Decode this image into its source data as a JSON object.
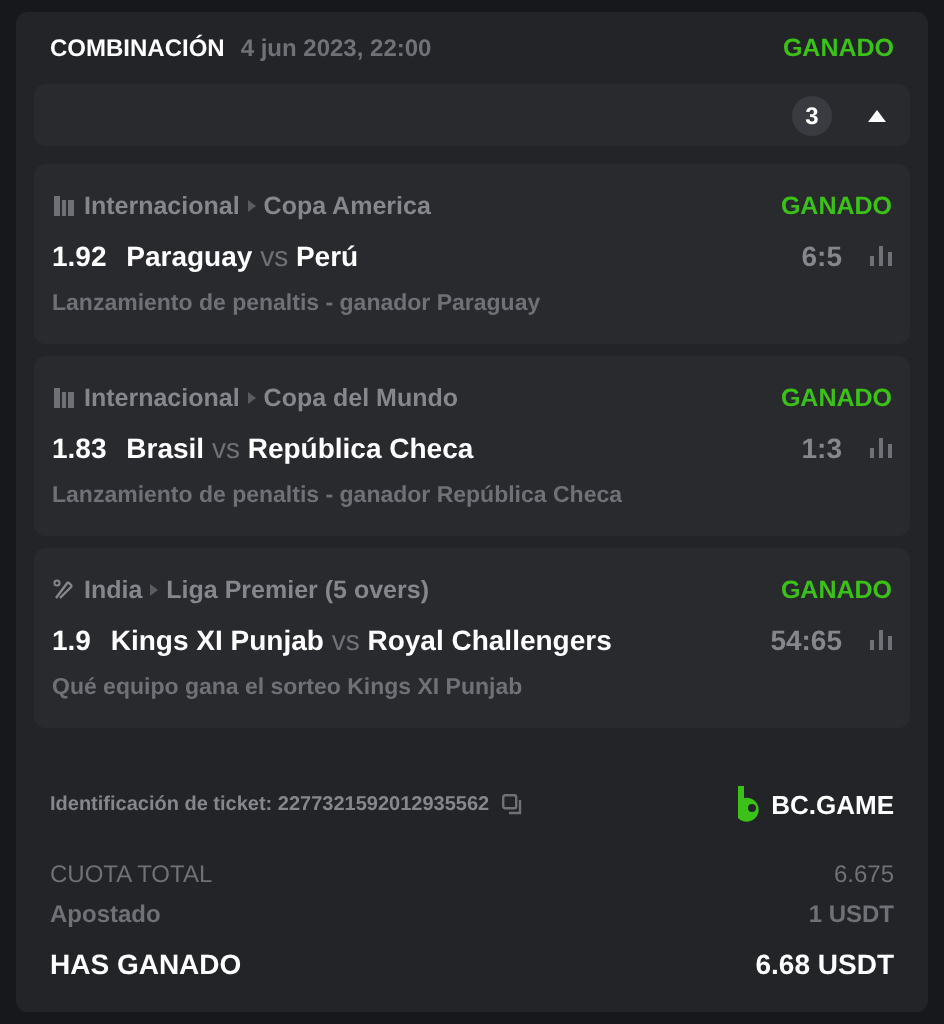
{
  "header": {
    "title": "COMBINACIÓN",
    "date": "4 jun 2023, 22:00",
    "status": "GANADO"
  },
  "collapse_bar": {
    "count": "3",
    "expanded": true
  },
  "legs": [
    {
      "kind": "esoccer",
      "country": "Internacional",
      "league": "Copa America",
      "status": "GANADO",
      "odds": "1.92",
      "home": "Paraguay",
      "vs": "vs",
      "away": "Perú",
      "score": "6:5",
      "market": "Lanzamiento de penaltis - ganador Paraguay"
    },
    {
      "kind": "esoccer",
      "country": "Internacional",
      "league": "Copa del Mundo",
      "status": "GANADO",
      "odds": "1.83",
      "home": "Brasil",
      "vs": "vs",
      "away": "República Checa",
      "score": "1:3",
      "market": "Lanzamiento de penaltis - ganador República Checa"
    },
    {
      "kind": "cricket",
      "country": "India",
      "league": "Liga Premier (5 overs)",
      "status": "GANADO",
      "odds": "1.9",
      "home": "Kings XI Punjab",
      "vs": "vs",
      "away": "Royal Challengers",
      "score": "54:65",
      "market": "Qué equipo gana el sorteo Kings XI Punjab"
    }
  ],
  "ticket": {
    "label": "Identificación de ticket: 2277321592012935562",
    "brand": "BC.GAME"
  },
  "summary": [
    {
      "kind": "muted",
      "label": "CUOTA TOTAL",
      "value": "6.675"
    },
    {
      "kind": "normal",
      "label": "Apostado",
      "value": "1 USDT"
    },
    {
      "kind": "total",
      "label": "HAS GANADO",
      "value": "6.68 USDT"
    }
  ]
}
